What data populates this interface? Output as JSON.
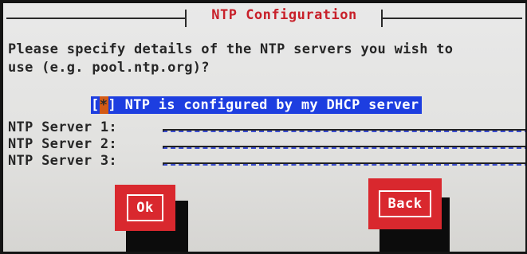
{
  "dialog": {
    "title": "NTP Configuration",
    "prompt": "Please specify details of the NTP servers you wish to\nuse (e.g. pool.ntp.org)?"
  },
  "checkbox": {
    "open": "[",
    "mark": "*",
    "close": "]",
    "label": " NTP is configured by my DHCP server"
  },
  "servers": [
    {
      "label": "NTP Server 1:",
      "value": ""
    },
    {
      "label": "NTP Server 2:",
      "value": ""
    },
    {
      "label": "NTP Server 3:",
      "value": ""
    }
  ],
  "buttons": {
    "ok": "Ok",
    "back": "Back"
  },
  "colors": {
    "title": "#c8202a",
    "highlight": "#1d3ee0",
    "button": "#d9282e",
    "field_line": "#3b4dcf"
  }
}
